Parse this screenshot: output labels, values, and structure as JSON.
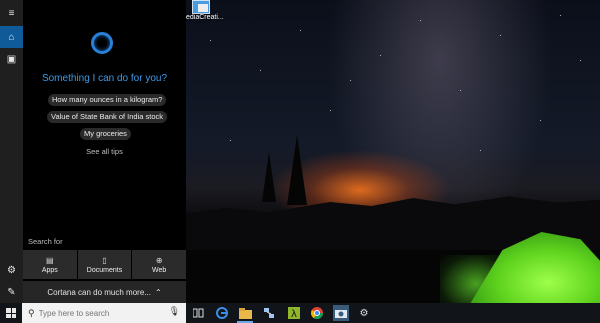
{
  "desktop": {
    "icon_label": "ediaCreati..."
  },
  "left_strip": {
    "items": [
      {
        "name": "hamburger-menu-icon",
        "glyph": "≡"
      },
      {
        "name": "home-icon",
        "glyph": "⌂"
      },
      {
        "name": "notebook-icon",
        "glyph": "▣"
      },
      {
        "name": "settings-icon",
        "glyph": "⚙"
      },
      {
        "name": "feedback-icon",
        "glyph": "✎"
      }
    ]
  },
  "cortana": {
    "prompt": "Something I can do for you?",
    "suggestions": [
      "How many ounces in a kilogram?",
      "Value of State Bank of India stock",
      "My groceries"
    ],
    "see_all_tips": "See all tips",
    "search_for_label": "Search for",
    "categories": [
      {
        "label": "Apps",
        "icon": "apps-icon"
      },
      {
        "label": "Documents",
        "icon": "document-icon"
      },
      {
        "label": "Web",
        "icon": "globe-icon"
      }
    ],
    "more_label": "Cortana can do much more...",
    "more_chevron": "⌃"
  },
  "taskbar": {
    "search_placeholder": "Type here to search",
    "apps": [
      "task-view-icon",
      "edge-icon",
      "file-explorer-icon",
      "network-app-icon",
      "lambda-app-icon",
      "chrome-icon",
      "camera-app-icon",
      "settings-icon"
    ]
  }
}
